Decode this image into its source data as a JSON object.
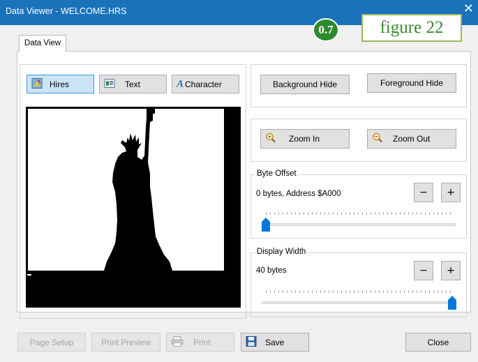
{
  "window": {
    "title": "Data Viewer - WELCOME.HRS",
    "close_glyph": "✕"
  },
  "overlay": {
    "badge": "0.7",
    "figure": "figure 22"
  },
  "tabs": [
    {
      "label": "Data View"
    }
  ],
  "modes": {
    "hires": "Hires",
    "text": "Text",
    "character": "Character",
    "selected": "Hires"
  },
  "layers": {
    "background": "Background Hide",
    "foreground": "Foreground Hide"
  },
  "zoom": {
    "in": "Zoom In",
    "out": "Zoom Out"
  },
  "byte_offset": {
    "title": "Byte Offset",
    "info": "0 bytes, Address $A000",
    "minus": "−",
    "plus": "+",
    "slider_fraction": 0.0
  },
  "display_width": {
    "title": "Display Width",
    "info": "40 bytes",
    "minus": "−",
    "plus": "+",
    "slider_fraction": 1.0
  },
  "footer": {
    "page_setup": "Page Setup",
    "print_preview": "Print Preview",
    "print": "Print",
    "save": "Save",
    "close": "Close"
  },
  "colors": {
    "titlebar": "#1a72bb",
    "accent": "#0078d7",
    "selected_bg": "#cce4f7"
  }
}
